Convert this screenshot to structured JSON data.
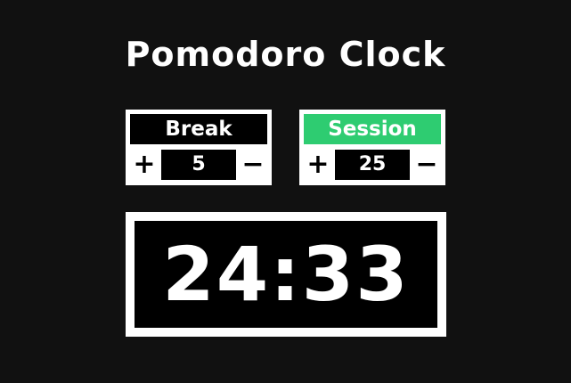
{
  "app": {
    "title": "Pomodoro Clock"
  },
  "break": {
    "label": "Break",
    "value": "5",
    "increment_symbol": "+",
    "decrement_symbol": "−"
  },
  "session": {
    "label": "Session",
    "value": "25",
    "increment_symbol": "+",
    "decrement_symbol": "−"
  },
  "timer": {
    "display": "24:33"
  },
  "colors": {
    "background": "#111111",
    "panel": "#ffffff",
    "dark": "#000000",
    "session_accent": "#2ecc71"
  }
}
